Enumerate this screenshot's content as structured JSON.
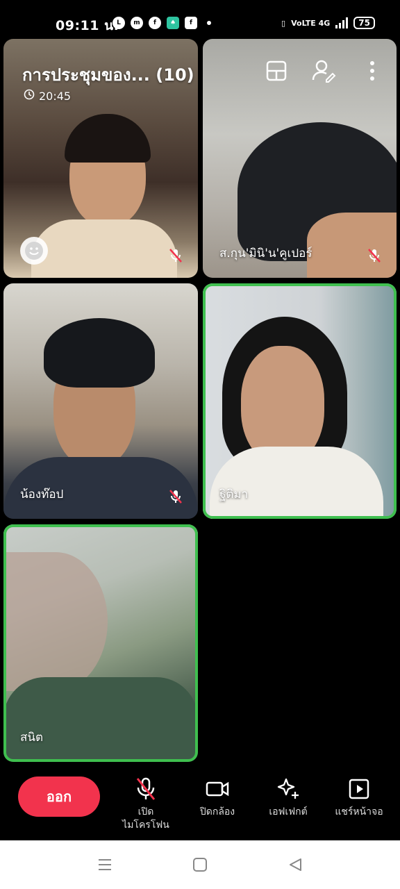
{
  "status_bar": {
    "time": "09:11 น.",
    "app_icons": [
      "line-icon",
      "messenger-icon",
      "facebook-icon",
      "green-app-icon",
      "facebook-square-icon",
      "dot-icon"
    ],
    "network": "VoLTE 4G",
    "battery": "75"
  },
  "meeting": {
    "title": "การประชุมของ... (10)",
    "duration": "20:45"
  },
  "participants": [
    {
      "name": "",
      "muted": true,
      "speaking": false
    },
    {
      "name": "ส.กุน'มินิ'น'คูเปอร์",
      "muted": true,
      "speaking": false
    },
    {
      "name": "น้องท๊อป",
      "muted": true,
      "speaking": false
    },
    {
      "name": "ฐิติมา",
      "muted": false,
      "speaking": true
    },
    {
      "name": "สนิต",
      "muted": false,
      "speaking": true
    }
  ],
  "controls": {
    "leave_label": "ออก",
    "mic_label_line1": "เปิด",
    "mic_label_line2": "ไมโครโฟน",
    "camera_label": "ปิดกล้อง",
    "effects_label": "เอฟเฟกต์",
    "share_label": "แชร์หน้าจอ"
  },
  "colors": {
    "speaking_border": "#3fbf4f",
    "leave_button": "#f2334d",
    "mute_icon": "#f2334d"
  }
}
